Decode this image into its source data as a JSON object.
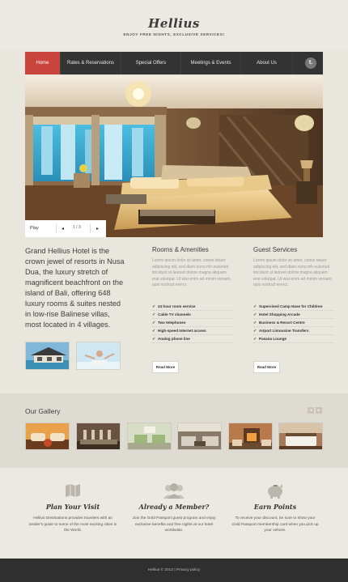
{
  "header": {
    "logo": "Hellius",
    "tagline": "ENJOY FREE NIGHTS, EXCLUSIVE SERVICES!"
  },
  "nav": {
    "items": [
      {
        "label": "Home",
        "active": true
      },
      {
        "label": "Rates & Reservations",
        "active": false
      },
      {
        "label": "Special Offers",
        "active": false
      },
      {
        "label": "Meetings & Events",
        "active": false
      },
      {
        "label": "About Us",
        "active": false
      }
    ],
    "social_icon": "t.",
    "active_color": "#c9443b"
  },
  "hero": {
    "play_label": "Play",
    "counter": "1 / 3"
  },
  "intro": {
    "text": "Grand Hellius Hotel is the crown jewel of resorts in Nusa Dua, the luxury stretch of magnificent beachfront on the island of Bali, offering 648 luxury rooms & suites nested in low-rise Balinese villas, most located in 4 villages."
  },
  "rooms": {
    "title": "Rooms & Amenities",
    "text": "Lorem ipsum dolor sit amet, conse tetuer adipiscing elit, sed diam nonu mh euismod tincidunt ut laoreet dolore magna aliquam erat volutpat. Ut wisi enim ad minim veniam, quis nostrud exerci.",
    "list": [
      "24 hour room service",
      "Cable TV channels",
      "Two telephones",
      "High-speed Internet access",
      "Analog phone line"
    ],
    "button": "Read More"
  },
  "guest": {
    "title": "Guest Services",
    "text": "Lorem ipsum dolor sit amet, conse tetuer adipiscing elit, sed diam nonu mh euismod tincidunt ut laoreet dolore magna aliquam erat volutpat. Ut wisi enim ad minim veniam, quis nostrud exerci.",
    "list": [
      "Supervised Camp Hase for Children",
      "Hotel Shopping Arcade",
      "Business & Resort Centre",
      "Airport Limousine Transfers",
      "Pasana Lounge"
    ],
    "button": "Read More"
  },
  "gallery": {
    "title": "Our Gallery",
    "prev": "◂",
    "next": "▸"
  },
  "features": [
    {
      "icon": "map-icon",
      "title": "Plan Your Visit",
      "text": "Hellius Destinations provides travelers with an insider's guide to some of the most exciting cities in the World."
    },
    {
      "icon": "members-icon",
      "title": "Already a Member?",
      "text": "Join the Gold Passport guest program and enjoy exclusive benefits and free nights at our hotel worldwide."
    },
    {
      "icon": "piggy-bank-icon",
      "title": "Earn Points",
      "text": "To receive your discount, be sure to show your Gold Passport membership card when you pick up your vehicle."
    }
  ],
  "footer": {
    "text": "Hellius © 2012 | Privacy policy"
  }
}
